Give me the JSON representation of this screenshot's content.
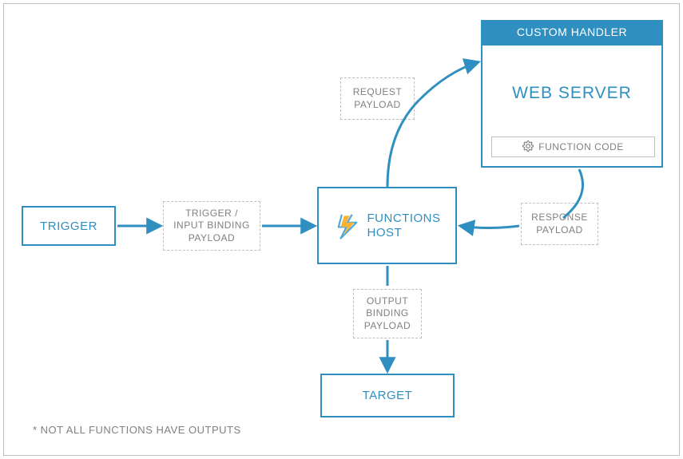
{
  "diagram": {
    "trigger": "TRIGGER",
    "trigger_payload": "TRIGGER /\nINPUT BINDING\nPAYLOAD",
    "functions_host": "FUNCTIONS\nHOST",
    "request_payload": "REQUEST\nPAYLOAD",
    "response_payload": "RESPONSE\nPAYLOAD",
    "output_payload": "OUTPUT\nBINDING\nPAYLOAD",
    "target": "TARGET",
    "custom_handler_header": "CUSTOM HANDLER",
    "web_server": "WEB SERVER",
    "function_code": "FUNCTION CODE",
    "footnote": "* NOT ALL FUNCTIONS HAVE OUTPUTS"
  },
  "colors": {
    "primary": "#2f8fc1",
    "gray": "#808080",
    "border_gray": "#bfbfbf",
    "bolt_yellow": "#f9b233",
    "bolt_blue": "#4aa8dd"
  }
}
